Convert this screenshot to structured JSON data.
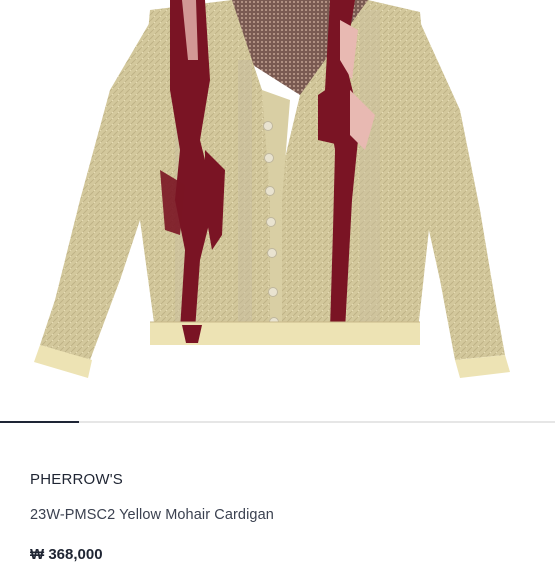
{
  "product": {
    "image_alt": "Yellow mohair cardigan with burgundy and pink pattern",
    "image_page": 1,
    "image_count": 7,
    "brand": "PHERROW'S",
    "name": "23W-PMSC2 Yellow Mohair Cardigan",
    "price": "₩ 368,000"
  },
  "colors": {
    "text_primary": "#1f2533",
    "text_secondary": "#3b4150",
    "indicator": "#1e2535",
    "knit_yellow": "#d8cc9c",
    "pattern_burgundy": "#7a1424",
    "pattern_pink": "#e8b9b2"
  }
}
